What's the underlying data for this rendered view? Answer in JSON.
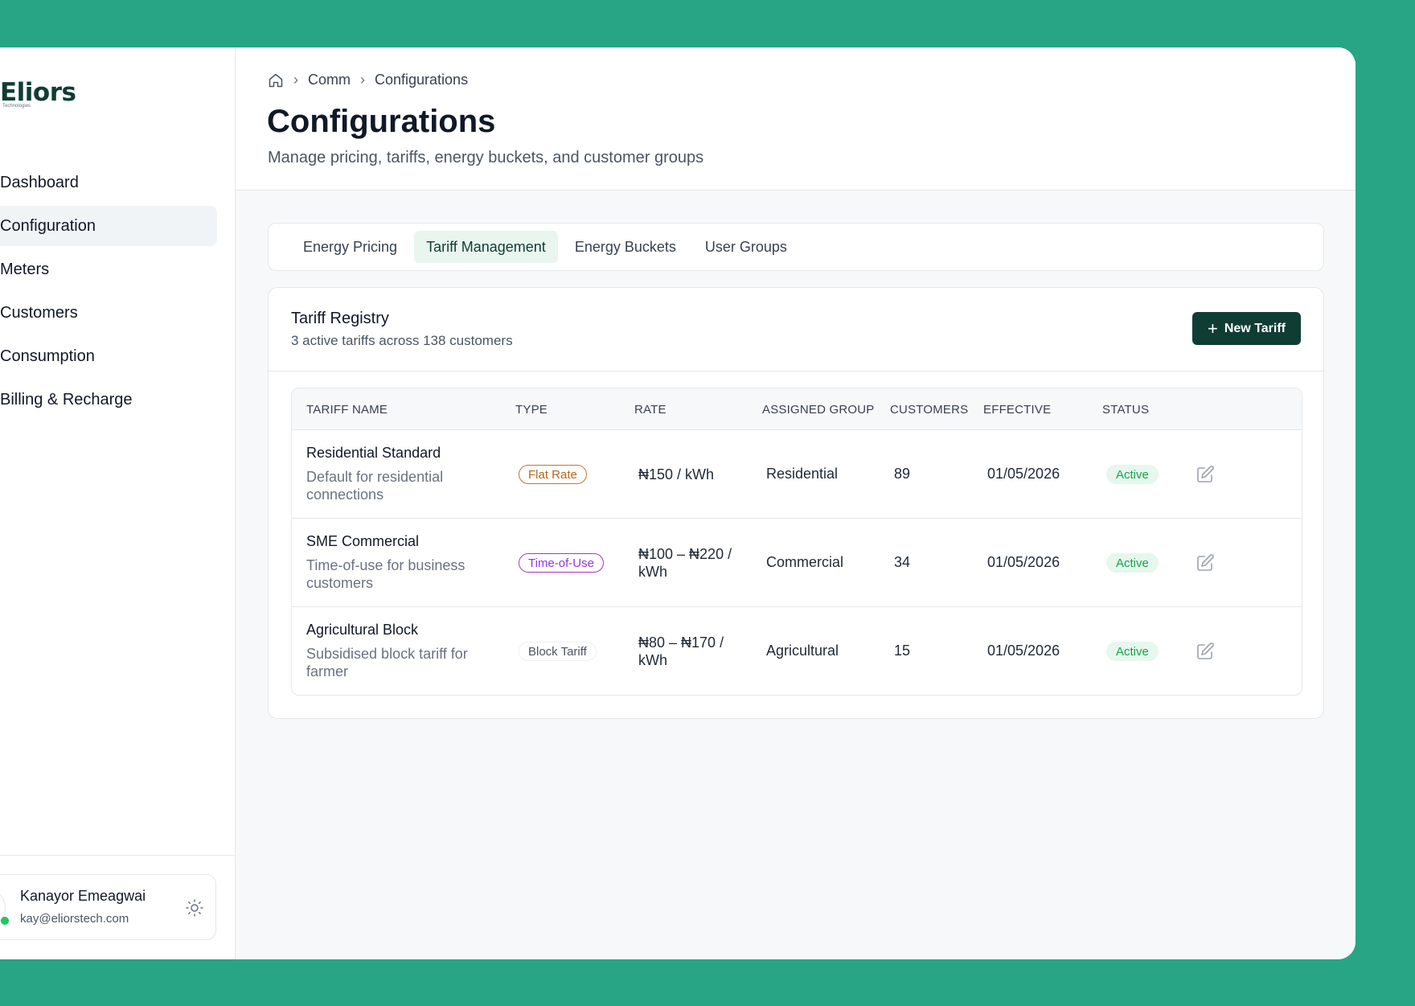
{
  "brand": {
    "name": "Eliors",
    "tagline": "Technologies"
  },
  "sidebar": {
    "items": [
      {
        "label": "Dashboard",
        "active": false
      },
      {
        "label": "Configuration",
        "active": true
      },
      {
        "label": "Meters",
        "active": false
      },
      {
        "label": "Customers",
        "active": false
      },
      {
        "label": "Consumption",
        "active": false
      },
      {
        "label": "Billing & Recharge",
        "active": false
      }
    ],
    "user": {
      "name": "Kanayor Emeagwai",
      "email": "kay@eliorstech.com",
      "status_color": "#22c55e"
    }
  },
  "breadcrumb": {
    "items": [
      "Comm",
      "Configurations"
    ]
  },
  "header": {
    "title": "Configurations",
    "subtitle": "Manage pricing, tariffs, energy buckets, and customer groups"
  },
  "tabs": [
    {
      "label": "Energy Pricing",
      "active": false
    },
    {
      "label": "Tariff Management",
      "active": true
    },
    {
      "label": "Energy Buckets",
      "active": false
    },
    {
      "label": "User Groups",
      "active": false
    }
  ],
  "registry": {
    "title": "Tariff Registry",
    "subtitle": "3 active tariffs across 138 customers",
    "new_button_label": "New Tariff",
    "columns": [
      "TARIFF NAME",
      "TYPE",
      "RATE",
      "ASSIGNED GROUP",
      "CUSTOMERS",
      "EFFECTIVE",
      "STATUS"
    ],
    "rows": [
      {
        "name": "Residential Standard",
        "description": "Default for residential connections",
        "type": "Flat Rate",
        "rate": "₦150 / kWh",
        "group": "Residential",
        "customers": "89",
        "effective": "01/05/2026",
        "status": "Active"
      },
      {
        "name": "SME Commercial",
        "description": "Time-of-use for business customers",
        "type": "Time-of-Use",
        "rate": "₦100 – ₦220 / kWh",
        "group": "Commercial",
        "customers": "34",
        "effective": "01/05/2026",
        "status": "Active"
      },
      {
        "name": "Agricultural Block",
        "description": "Subsidised block tariff for farmer",
        "type": "Block Tariff",
        "rate": "₦80 – ₦170 / kWh",
        "group": "Agricultural",
        "customers": "15",
        "effective": "01/05/2026",
        "status": "Active"
      }
    ]
  },
  "colors": {
    "background": "#27a584",
    "primary": "#0f3d33",
    "active_badge": "#16a34a",
    "flat_rate": "#b5651d",
    "time_of_use": "#9333ea"
  }
}
